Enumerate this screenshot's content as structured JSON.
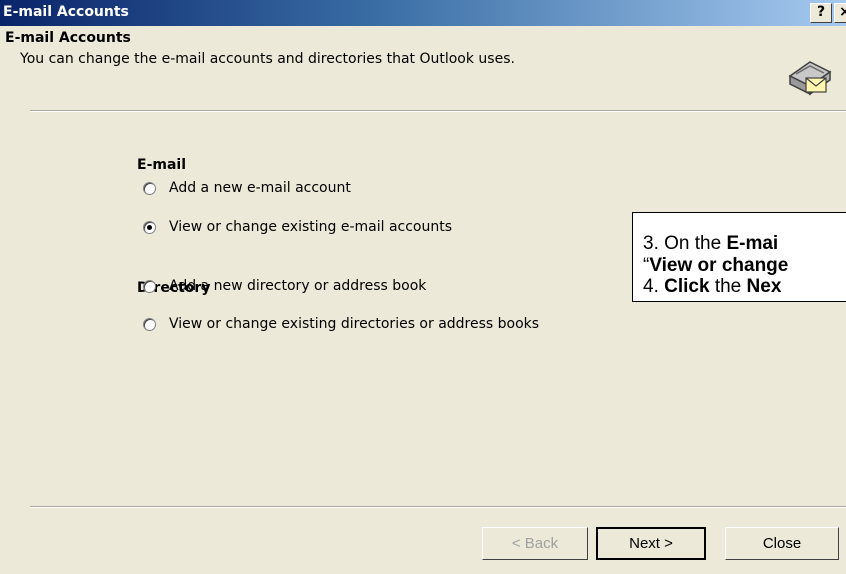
{
  "window": {
    "title": "E-mail Accounts",
    "help_label": "?",
    "close_label": "×"
  },
  "header": {
    "title": "E-mail Accounts",
    "subtitle": "You can change the e-mail accounts and directories that Outlook uses.",
    "icon": "mail-envelope-icon"
  },
  "email_group": {
    "label": "E-mail",
    "options": [
      {
        "label": "Add a new e-mail account",
        "selected": false
      },
      {
        "label": "View or change existing e-mail accounts",
        "selected": true
      }
    ]
  },
  "directory_group": {
    "label": "Directory",
    "options": [
      {
        "label": "Add a new directory or address book",
        "selected": false
      },
      {
        "label": "View or change existing directories or address books",
        "selected": false
      }
    ]
  },
  "callout": {
    "line1_prefix": "3.  On the ",
    "line1_bold": "E-mai",
    "line2_open_quote": "“",
    "line2_bold": "View or change",
    "line3_prefix": "4.  ",
    "line3_bold1": "Click",
    "line3_middle": " the ",
    "line3_bold2": "Nex"
  },
  "buttons": {
    "back": "< Back",
    "next": "Next >",
    "close": "Close"
  },
  "colors": {
    "title_bar_start": "#0a246a",
    "title_bar_end": "#a6caf0",
    "dialog_background": "#ece9d8"
  }
}
